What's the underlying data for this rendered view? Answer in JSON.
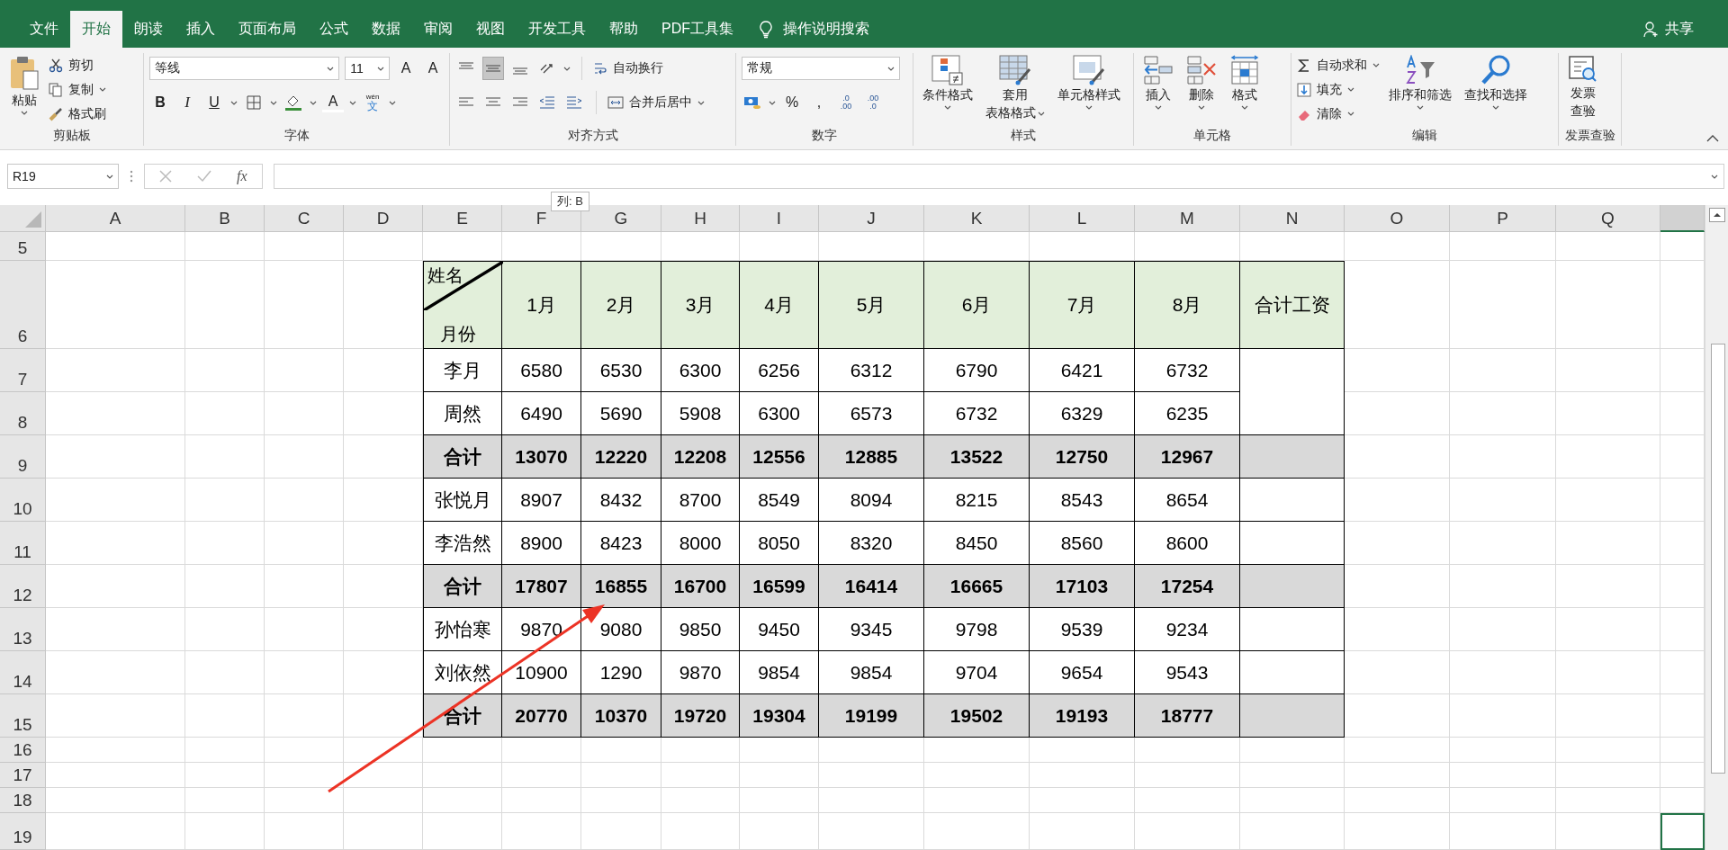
{
  "ribbon_tabs": [
    {
      "label": "文件",
      "selected": false
    },
    {
      "label": "开始",
      "selected": true
    },
    {
      "label": "朗读",
      "selected": false
    },
    {
      "label": "插入",
      "selected": false
    },
    {
      "label": "页面布局",
      "selected": false
    },
    {
      "label": "公式",
      "selected": false
    },
    {
      "label": "数据",
      "selected": false
    },
    {
      "label": "审阅",
      "selected": false
    },
    {
      "label": "视图",
      "selected": false
    },
    {
      "label": "开发工具",
      "selected": false
    },
    {
      "label": "帮助",
      "selected": false
    },
    {
      "label": "PDF工具集",
      "selected": false
    }
  ],
  "tell_me": "操作说明搜索",
  "share": "共享",
  "clipboard": {
    "paste": "粘贴",
    "cut": "剪切",
    "copy": "复制",
    "format_painter": "格式刷",
    "label": "剪贴板"
  },
  "font": {
    "name": "等线",
    "size": "11",
    "grow": "A",
    "shrink": "A",
    "bold": "B",
    "italic": "I",
    "underline": "U",
    "font_color": "A",
    "phonetic_top": "wén",
    "phonetic": "文",
    "label": "字体"
  },
  "alignment": {
    "vertical": [
      {
        "selected": false
      },
      {
        "selected": true
      },
      {
        "selected": false
      }
    ],
    "wrap": "自动换行",
    "merge": "合并后居中",
    "label": "对齐方式"
  },
  "number": {
    "format": "常规",
    "percent": "%",
    "comma": ",",
    "increase_decimal": [
      ".0",
      ".00"
    ],
    "decrease_decimal": [
      ".00",
      ".0"
    ],
    "label": "数字"
  },
  "styles": {
    "conditional": "条件格式",
    "table_top": "套用",
    "table_bottom": "表格格式",
    "cell_styles": "单元格样式",
    "label": "样式"
  },
  "cells": {
    "insert": "插入",
    "delete": "删除",
    "format": "格式",
    "label": "单元格"
  },
  "editing": {
    "autosum": "自动求和",
    "fill": "填充",
    "clear": "清除",
    "sort": "排序和筛选",
    "find": "查找和选择",
    "label": "编辑"
  },
  "invoice": {
    "button_top": "发票",
    "button_bottom": "查验",
    "label": "发票查验"
  },
  "formula_bar": {
    "name_box": "R19",
    "fx": "fx",
    "tooltip": "列: B"
  },
  "sheet": {
    "columns": [
      "A",
      "B",
      "C",
      "D",
      "E",
      "F",
      "G",
      "H",
      "I",
      "J",
      "K",
      "L",
      "M",
      "N",
      "O",
      "P",
      "Q"
    ],
    "rows": [
      "5",
      "6",
      "7",
      "8",
      "9",
      "10",
      "11",
      "12",
      "13",
      "14",
      "15",
      "16",
      "17",
      "18",
      "19"
    ]
  },
  "table": {
    "corner_top": "姓名",
    "corner_bottom": "月份",
    "months": [
      "1月",
      "2月",
      "3月",
      "4月",
      "5月",
      "6月",
      "7月",
      "8月"
    ],
    "total_header": "合计工资",
    "rows": [
      {
        "kind": "data",
        "name": "李月",
        "values": [
          "6580",
          "6530",
          "6300",
          "6256",
          "6312",
          "6790",
          "6421",
          "6732"
        ],
        "total_merged_with_next": true
      },
      {
        "kind": "data",
        "name": "周然",
        "values": [
          "6490",
          "5690",
          "5908",
          "6300",
          "6573",
          "6732",
          "6329",
          "6235"
        ],
        "total_merged_with_next": false
      },
      {
        "kind": "total",
        "name": "合计",
        "values": [
          "13070",
          "12220",
          "12208",
          "12556",
          "12885",
          "13522",
          "12750",
          "12967"
        ],
        "total_merged_with_next": false
      },
      {
        "kind": "data",
        "name": "张悦月",
        "values": [
          "8907",
          "8432",
          "8700",
          "8549",
          "8094",
          "8215",
          "8543",
          "8654"
        ],
        "total_merged_with_next": false
      },
      {
        "kind": "data",
        "name": "李浩然",
        "values": [
          "8900",
          "8423",
          "8000",
          "8050",
          "8320",
          "8450",
          "8560",
          "8600"
        ],
        "total_merged_with_next": false
      },
      {
        "kind": "total",
        "name": "合计",
        "values": [
          "17807",
          "16855",
          "16700",
          "16599",
          "16414",
          "16665",
          "17103",
          "17254"
        ],
        "total_merged_with_next": false
      },
      {
        "kind": "data",
        "name": "孙怡寒",
        "values": [
          "9870",
          "9080",
          "9850",
          "9450",
          "9345",
          "9798",
          "9539",
          "9234"
        ],
        "total_merged_with_next": false
      },
      {
        "kind": "data",
        "name": "刘依然",
        "values": [
          "10900",
          "1290",
          "9870",
          "9854",
          "9854",
          "9704",
          "9654",
          "9543"
        ],
        "total_merged_with_next": false
      },
      {
        "kind": "total",
        "name": "合计",
        "values": [
          "20770",
          "10370",
          "19720",
          "19304",
          "19199",
          "19502",
          "19193",
          "18777"
        ],
        "total_merged_with_next": false
      }
    ]
  }
}
